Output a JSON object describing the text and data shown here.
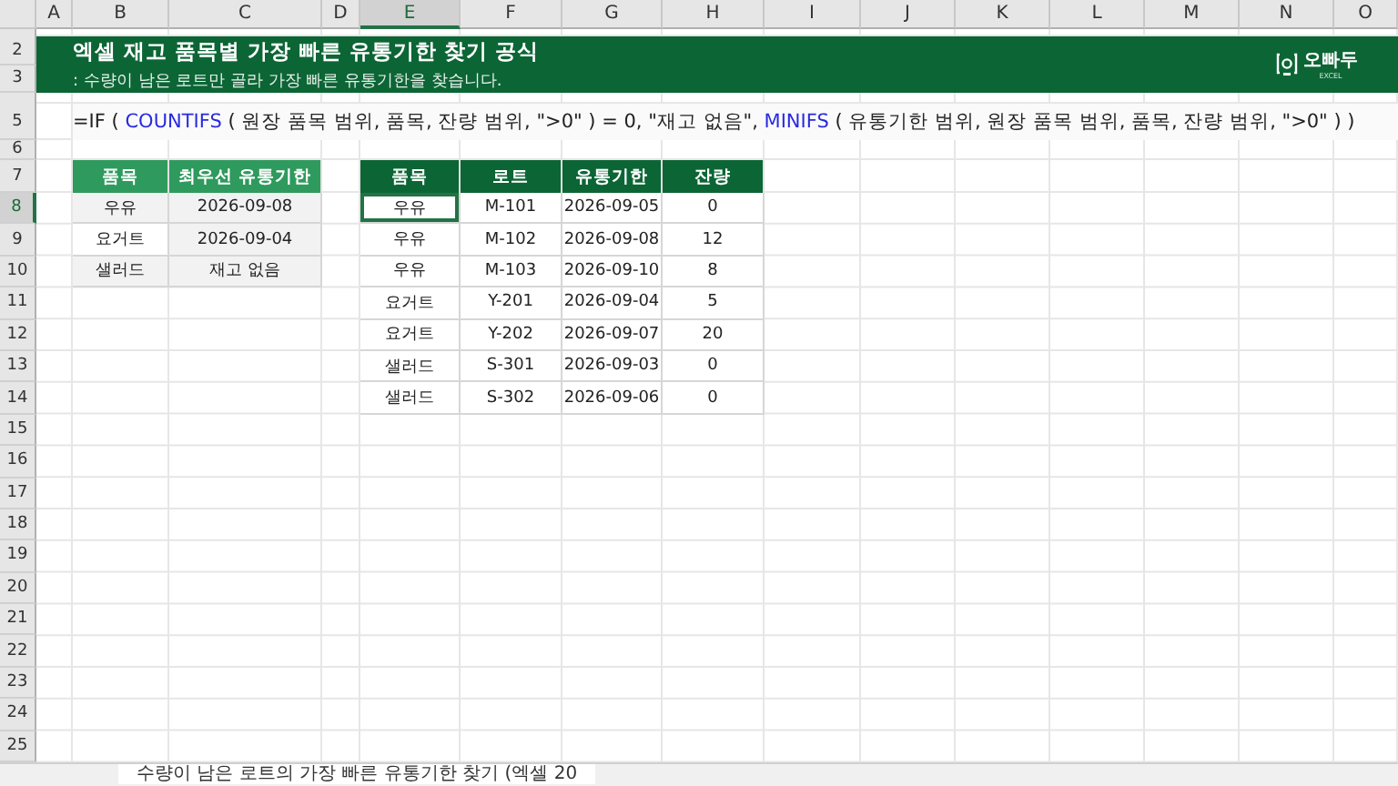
{
  "column_headers": [
    {
      "label": "A",
      "selected": false
    },
    {
      "label": "B",
      "selected": false
    },
    {
      "label": "C",
      "selected": false
    },
    {
      "label": "D",
      "selected": false
    },
    {
      "label": "E",
      "selected": true
    },
    {
      "label": "F",
      "selected": false
    },
    {
      "label": "G",
      "selected": false
    },
    {
      "label": "H",
      "selected": false
    },
    {
      "label": "I",
      "selected": false
    },
    {
      "label": "J",
      "selected": false
    },
    {
      "label": "K",
      "selected": false
    },
    {
      "label": "L",
      "selected": false
    },
    {
      "label": "M",
      "selected": false
    },
    {
      "label": "N",
      "selected": false
    },
    {
      "label": "O",
      "selected": false
    }
  ],
  "row_headers": [
    {
      "label": "2",
      "selected": false
    },
    {
      "label": "3",
      "selected": false
    },
    {
      "label": "5",
      "selected": false
    },
    {
      "label": "6",
      "selected": false
    },
    {
      "label": "7",
      "selected": false
    },
    {
      "label": "8",
      "selected": true
    },
    {
      "label": "9",
      "selected": false
    },
    {
      "label": "10",
      "selected": false
    },
    {
      "label": "11",
      "selected": false
    },
    {
      "label": "12",
      "selected": false
    },
    {
      "label": "13",
      "selected": false
    },
    {
      "label": "14",
      "selected": false
    },
    {
      "label": "15",
      "selected": false
    },
    {
      "label": "16",
      "selected": false
    },
    {
      "label": "17",
      "selected": false
    },
    {
      "label": "18",
      "selected": false
    },
    {
      "label": "19",
      "selected": false
    },
    {
      "label": "20",
      "selected": false
    },
    {
      "label": "21",
      "selected": false
    },
    {
      "label": "22",
      "selected": false
    },
    {
      "label": "23",
      "selected": false
    },
    {
      "label": "24",
      "selected": false
    },
    {
      "label": "25",
      "selected": false
    }
  ],
  "banner": {
    "title": "엑셀 재고 품목별 가장 빠른 유통기한 찾기 공식",
    "subtitle": ": 수량이 남은 로트만 골라 가장 빠른 유통기한을 찾습니다.",
    "logo": {
      "name": "오빠두",
      "tag": "EXCEL"
    }
  },
  "formula": [
    {
      "kind": "text",
      "text": "=IF ( "
    },
    {
      "kind": "function",
      "text": "COUNTIFS"
    },
    {
      "kind": "text",
      "text": " ( 원장 품목 범위, 품목, 잔량 범위, \">0\" ) = 0, \"재고 없음\", "
    },
    {
      "kind": "function",
      "text": "MINIFS"
    },
    {
      "kind": "text",
      "text": " ( 유통기한 범위, 원장 품목 범위, 품목, 잔량 범위, \">0\" ) )"
    }
  ],
  "summary_table": {
    "columns": [
      "품목",
      "최우선 유통기한"
    ],
    "rows": [
      {
        "cells": [
          {
            "text": "우유",
            "shaded": true
          },
          {
            "text": "2026-09-08",
            "shaded": true
          }
        ]
      },
      {
        "cells": [
          {
            "text": "요거트",
            "shaded": false
          },
          {
            "text": "2026-09-04",
            "shaded": true
          }
        ]
      },
      {
        "cells": [
          {
            "text": "샐러드",
            "shaded": true
          },
          {
            "text": "재고 없음",
            "shaded": true
          }
        ]
      }
    ]
  },
  "ledger_table": {
    "columns": [
      "품목",
      "로트",
      "유통기한",
      "잔량"
    ],
    "rows": [
      {
        "cells": [
          {
            "text": "우유",
            "selected": true
          },
          {
            "text": "M-101",
            "selected": false
          },
          {
            "text": "2026-09-05",
            "selected": false
          },
          {
            "text": "0",
            "selected": false
          }
        ]
      },
      {
        "cells": [
          {
            "text": "우유",
            "selected": false
          },
          {
            "text": "M-102",
            "selected": false
          },
          {
            "text": "2026-09-08",
            "selected": false
          },
          {
            "text": "12",
            "selected": false
          }
        ]
      },
      {
        "cells": [
          {
            "text": "우유",
            "selected": false
          },
          {
            "text": "M-103",
            "selected": false
          },
          {
            "text": "2026-09-10",
            "selected": false
          },
          {
            "text": "8",
            "selected": false
          }
        ]
      },
      {
        "cells": [
          {
            "text": "요거트",
            "selected": false
          },
          {
            "text": "Y-201",
            "selected": false
          },
          {
            "text": "2026-09-04",
            "selected": false
          },
          {
            "text": "5",
            "selected": false
          }
        ]
      },
      {
        "cells": [
          {
            "text": "요거트",
            "selected": false
          },
          {
            "text": "Y-202",
            "selected": false
          },
          {
            "text": "2026-09-07",
            "selected": false
          },
          {
            "text": "20",
            "selected": false
          }
        ]
      },
      {
        "cells": [
          {
            "text": "샐러드",
            "selected": false
          },
          {
            "text": "S-301",
            "selected": false
          },
          {
            "text": "2026-09-03",
            "selected": false
          },
          {
            "text": "0",
            "selected": false
          }
        ]
      },
      {
        "cells": [
          {
            "text": "샐러드",
            "selected": false
          },
          {
            "text": "S-302",
            "selected": false
          },
          {
            "text": "2026-09-06",
            "selected": false
          },
          {
            "text": "0",
            "selected": false
          }
        ]
      }
    ]
  },
  "sheet_tab": {
    "label": "수량이 남은 로트의 가장 빠른 유통기한 찾기 (엑셀 20",
    "selected": true
  }
}
